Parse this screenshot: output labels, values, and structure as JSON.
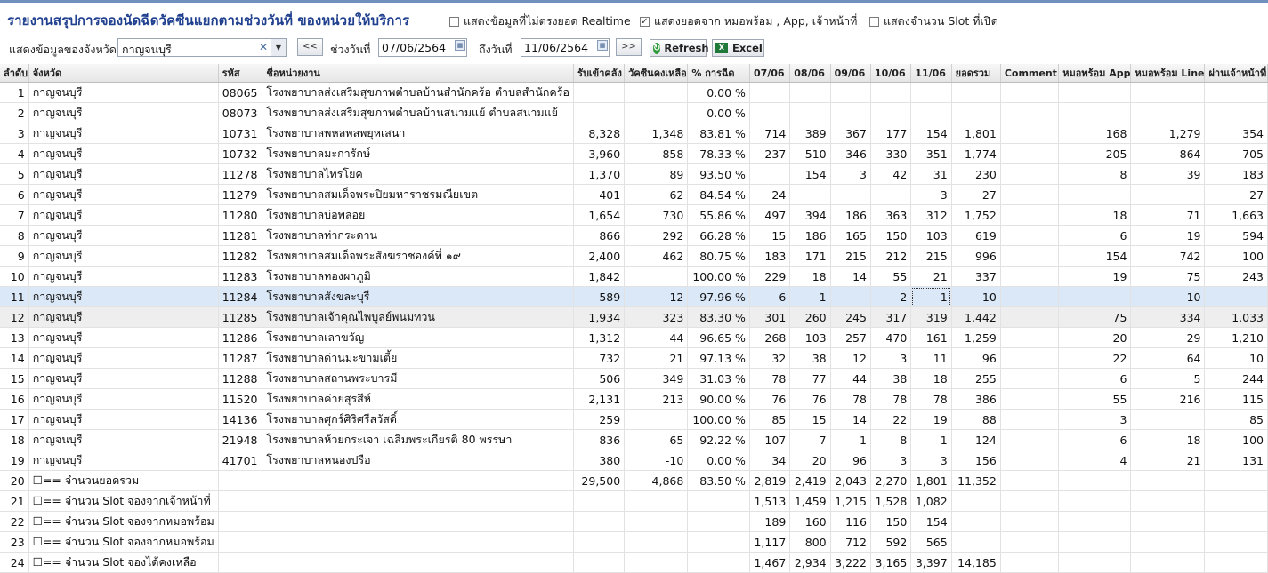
{
  "header": {
    "title": "รายงานสรุปการจองนัดฉีดวัคซีนแยกตามช่วงวันที่ ของหน่วยให้บริการ",
    "options": [
      {
        "label": "แสดงข้อมูลที่ไม่ตรงยอด Realtime",
        "checked": false
      },
      {
        "label": "แสดงยอดจาก หมอพร้อม , App, เจ้าหน้าที่",
        "checked": true
      },
      {
        "label": "แสดงจำนวน Slot ที่เปิด",
        "checked": false
      }
    ]
  },
  "filters": {
    "province_label": "แสดงข้อมูลของจังหวัด",
    "province_value": "กาญจนบุรี",
    "prev_label": "<<",
    "range_label": "ช่วงวันที่",
    "date_from": "07/06/2564",
    "to_label": "ถึงวันที่",
    "date_to": "11/06/2564",
    "next_label": ">>",
    "refresh_label": "Refresh",
    "excel_label": "Excel"
  },
  "table": {
    "columns": [
      "ลำดับ",
      "จังหวัด",
      "รหัส",
      "ชื่อหน่วยงาน",
      "รับเข้าคลัง",
      "วัคซีนคงเหลือ",
      "% การฉีด",
      "07/06",
      "08/06",
      "09/06",
      "10/06",
      "11/06",
      "ยอดรวม",
      "Comment",
      "หมอพร้อม App",
      "หมอพร้อม Line",
      "ผ่านเจ้าหน้าที่"
    ],
    "rows": [
      [
        "1",
        "กาญจนบุรี",
        "08065",
        "โรงพยาบาลส่งเสริมสุขภาพตำบลบ้านสำนักคร้อ ตำบลสำนักคร้อ",
        "",
        "",
        "0.00 %",
        "",
        "",
        "",
        "",
        "",
        "",
        "",
        "",
        "",
        ""
      ],
      [
        "2",
        "กาญจนบุรี",
        "08073",
        "โรงพยาบาลส่งเสริมสุขภาพตำบลบ้านสนามแย้ ตำบลสนามแย้",
        "",
        "",
        "0.00 %",
        "",
        "",
        "",
        "",
        "",
        "",
        "",
        "",
        "",
        ""
      ],
      [
        "3",
        "กาญจนบุรี",
        "10731",
        "โรงพยาบาลพหลพลพยุหเสนา",
        "8,328",
        "1,348",
        "83.81 %",
        "714",
        "389",
        "367",
        "177",
        "154",
        "1,801",
        "",
        "168",
        "1,279",
        "354"
      ],
      [
        "4",
        "กาญจนบุรี",
        "10732",
        "โรงพยาบาลมะการักษ์",
        "3,960",
        "858",
        "78.33 %",
        "237",
        "510",
        "346",
        "330",
        "351",
        "1,774",
        "",
        "205",
        "864",
        "705"
      ],
      [
        "5",
        "กาญจนบุรี",
        "11278",
        "โรงพยาบาลไทรโยค",
        "1,370",
        "89",
        "93.50 %",
        "",
        "154",
        "3",
        "42",
        "31",
        "230",
        "",
        "8",
        "39",
        "183"
      ],
      [
        "6",
        "กาญจนบุรี",
        "11279",
        "โรงพยาบาลสมเด็จพระปิยมหาราชรมณียเขต",
        "401",
        "62",
        "84.54 %",
        "24",
        "",
        "",
        "",
        "3",
        "27",
        "",
        "",
        "",
        "27"
      ],
      [
        "7",
        "กาญจนบุรี",
        "11280",
        "โรงพยาบาลบ่อพลอย",
        "1,654",
        "730",
        "55.86 %",
        "497",
        "394",
        "186",
        "363",
        "312",
        "1,752",
        "",
        "18",
        "71",
        "1,663"
      ],
      [
        "8",
        "กาญจนบุรี",
        "11281",
        "โรงพยาบาลท่ากระดาน",
        "866",
        "292",
        "66.28 %",
        "15",
        "186",
        "165",
        "150",
        "103",
        "619",
        "",
        "6",
        "19",
        "594"
      ],
      [
        "9",
        "กาญจนบุรี",
        "11282",
        "โรงพยาบาลสมเด็จพระสังฆราชองค์ที่ ๑๙",
        "2,400",
        "462",
        "80.75 %",
        "183",
        "171",
        "215",
        "212",
        "215",
        "996",
        "",
        "154",
        "742",
        "100"
      ],
      [
        "10",
        "กาญจนบุรี",
        "11283",
        "โรงพยาบาลทองผาภูมิ",
        "1,842",
        "",
        "100.00 %",
        "229",
        "18",
        "14",
        "55",
        "21",
        "337",
        "",
        "19",
        "75",
        "243"
      ],
      [
        "11",
        "กาญจนบุรี",
        "11284",
        "โรงพยาบาลสังขละบุรี",
        "589",
        "12",
        "97.96 %",
        "6",
        "1",
        "",
        "2",
        "1",
        "10",
        "",
        "",
        "10",
        ""
      ],
      [
        "12",
        "กาญจนบุรี",
        "11285",
        "โรงพยาบาลเจ้าคุณไพบูลย์พนมทวน",
        "1,934",
        "323",
        "83.30 %",
        "301",
        "260",
        "245",
        "317",
        "319",
        "1,442",
        "",
        "75",
        "334",
        "1,033"
      ],
      [
        "13",
        "กาญจนบุรี",
        "11286",
        "โรงพยาบาลเลาขวัญ",
        "1,312",
        "44",
        "96.65 %",
        "268",
        "103",
        "257",
        "470",
        "161",
        "1,259",
        "",
        "20",
        "29",
        "1,210"
      ],
      [
        "14",
        "กาญจนบุรี",
        "11287",
        "โรงพยาบาลด่านมะขามเตี้ย",
        "732",
        "21",
        "97.13 %",
        "32",
        "38",
        "12",
        "3",
        "11",
        "96",
        "",
        "22",
        "64",
        "10"
      ],
      [
        "15",
        "กาญจนบุรี",
        "11288",
        "โรงพยาบาลสถานพระบารมี",
        "506",
        "349",
        "31.03 %",
        "78",
        "77",
        "44",
        "38",
        "18",
        "255",
        "",
        "6",
        "5",
        "244"
      ],
      [
        "16",
        "กาญจนบุรี",
        "11520",
        "โรงพยาบาลค่ายสุรสีห์",
        "2,131",
        "213",
        "90.00 %",
        "76",
        "76",
        "78",
        "78",
        "78",
        "386",
        "",
        "55",
        "216",
        "115"
      ],
      [
        "17",
        "กาญจนบุรี",
        "14136",
        "โรงพยาบาลศุกร์ศิริศรีสวัสดิ์",
        "259",
        "",
        "100.00 %",
        "85",
        "15",
        "14",
        "22",
        "19",
        "88",
        "",
        "3",
        "",
        "85"
      ],
      [
        "18",
        "กาญจนบุรี",
        "21948",
        "โรงพยาบาลห้วยกระเจา เฉลิมพระเกียรติ 80 พรรษา",
        "836",
        "65",
        "92.22 %",
        "107",
        "7",
        "1",
        "8",
        "1",
        "124",
        "",
        "6",
        "18",
        "100"
      ],
      [
        "19",
        "กาญจนบุรี",
        "41701",
        "โรงพยาบาลหนองปรือ",
        "380",
        "-10",
        "0.00 %",
        "34",
        "20",
        "96",
        "3",
        "3",
        "156",
        "",
        "4",
        "21",
        "131"
      ],
      [
        "20",
        "☐== จำนวนยอดรวม",
        "",
        "",
        "29,500",
        "4,868",
        "83.50 %",
        "2,819",
        "2,419",
        "2,043",
        "2,270",
        "1,801",
        "11,352",
        "",
        "",
        "",
        ""
      ],
      [
        "21",
        "☐== จำนวน Slot จองจากเจ้าหน้าที่",
        "",
        "",
        "",
        "",
        "",
        "1,513",
        "1,459",
        "1,215",
        "1,528",
        "1,082",
        "",
        "",
        "",
        "",
        ""
      ],
      [
        "22",
        "☐== จำนวน Slot จองจากหมอพร้อม",
        "",
        "",
        "",
        "",
        "",
        "189",
        "160",
        "116",
        "150",
        "154",
        "",
        "",
        "",
        "",
        ""
      ],
      [
        "23",
        "☐== จำนวน Slot จองจากหมอพร้อม",
        "",
        "",
        "",
        "",
        "",
        "1,117",
        "800",
        "712",
        "592",
        "565",
        "",
        "",
        "",
        "",
        ""
      ],
      [
        "24",
        "☐== จำนวน Slot จองได้คงเหลือ",
        "",
        "",
        "",
        "",
        "",
        "1,467",
        "2,934",
        "3,222",
        "3,165",
        "3,397",
        "14,185",
        "",
        "",
        "",
        ""
      ]
    ]
  }
}
